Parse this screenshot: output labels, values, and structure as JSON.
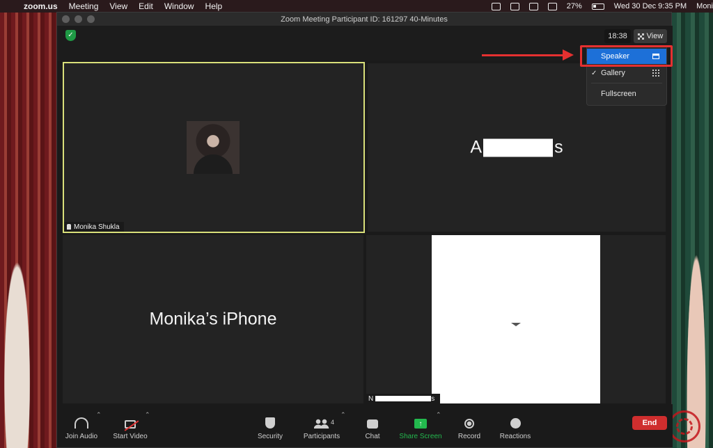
{
  "menubar": {
    "app": "zoom.us",
    "items": [
      "Meeting",
      "View",
      "Edit",
      "Window",
      "Help"
    ],
    "battery": "27%",
    "datetime": "Wed 30 Dec  9:35 PM",
    "user": "Moni"
  },
  "window": {
    "title": "Zoom Meeting Participant ID: 161297   40-Minutes",
    "timer": "18:38",
    "view_label": "View"
  },
  "view_menu": {
    "speaker": "Speaker",
    "gallery": "Gallery",
    "fullscreen": "Fullscreen",
    "checkmark": "✓"
  },
  "tiles": {
    "t1_name": "Monika Shukla",
    "t2_prefix": "A",
    "t2_suffix": "s",
    "t3_name": "Monika’s iPhone",
    "t4_prefix": "N",
    "t4_suffix": "s"
  },
  "toolbar": {
    "join_audio": "Join Audio",
    "start_video": "Start Video",
    "security": "Security",
    "participants": "Participants",
    "participants_count": "4",
    "chat": "Chat",
    "share_screen": "Share Screen",
    "record": "Record",
    "reactions": "Reactions",
    "end": "End"
  },
  "colors": {
    "accent_blue": "#1d70d8",
    "share_green": "#23b94e",
    "end_red": "#cf2e2e",
    "active_speaker_border": "#d9e07a",
    "annotation_red": "#e53030"
  }
}
